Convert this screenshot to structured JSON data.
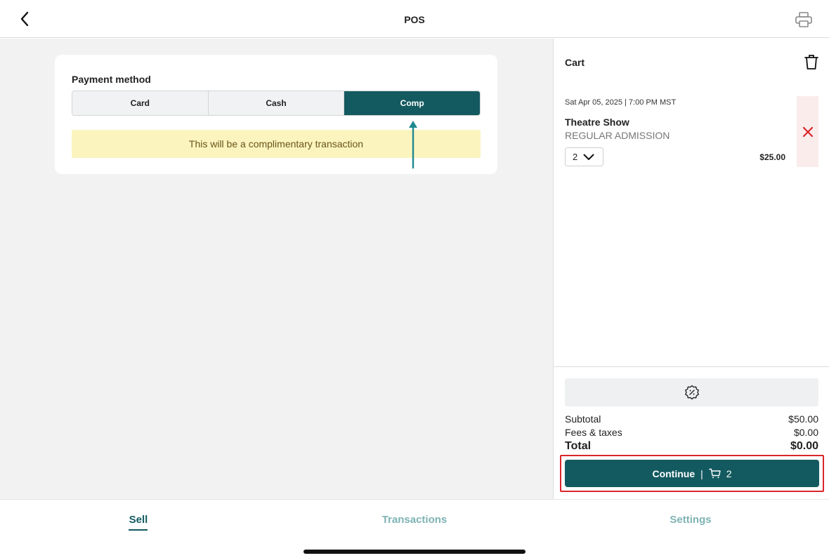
{
  "header": {
    "title": "POS",
    "back_icon": "chevron-left-icon",
    "print_icon": "printer-icon"
  },
  "payment": {
    "label": "Payment method",
    "options": [
      "Card",
      "Cash",
      "Comp"
    ],
    "selected": "Comp",
    "note": "This will be a complimentary transaction"
  },
  "cart": {
    "title": "Cart",
    "clear_icon": "trash-icon",
    "item": {
      "date": "Sat Apr 05, 2025 | 7:00 PM MST",
      "event": "Theatre Show",
      "ticket_type": "REGULAR ADMISSION",
      "quantity": "2",
      "price": "$25.00",
      "remove_icon": "close-icon"
    },
    "discount_icon": "discount-badge-icon",
    "subtotal_label": "Subtotal",
    "subtotal_value": "$50.00",
    "fees_label": "Fees & taxes",
    "fees_value": "$0.00",
    "total_label": "Total",
    "total_value": "$0.00",
    "continue_label": "Continue",
    "continue_separator": "|",
    "cart_icon": "cart-icon",
    "cart_count": "2"
  },
  "tabs": [
    {
      "label": "Sell",
      "active": true
    },
    {
      "label": "Transactions",
      "active": false
    },
    {
      "label": "Settings",
      "active": false
    }
  ],
  "colors": {
    "accent": "#135a60",
    "note_background": "#fbf4bf",
    "remove_red": "#d9262b",
    "tab_inactive": "#7fb3b4"
  }
}
